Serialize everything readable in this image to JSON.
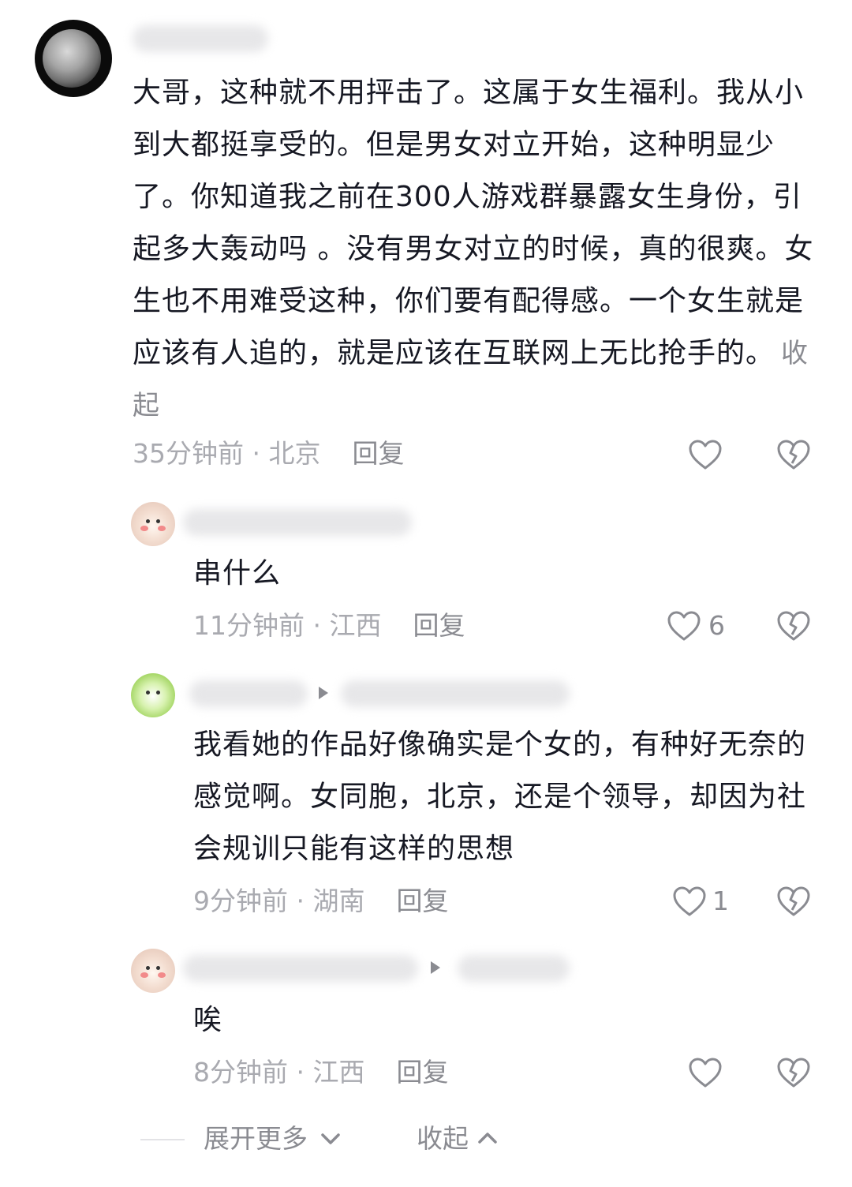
{
  "comment": {
    "text": "大哥，这种就不用抨击了。这属于女生福利。我从小到大都挺享受的。但是男女对立开始，这种明显少了。你知道我之前在300人游戏群暴露女生身份，引起多大轰动吗 。没有男女对立的时候，真的很爽。女生也不用难受这种，你们要有配得感。一个女生就是应该有人追的，就是应该在互联网上无比抢手的。",
    "collapse_label": "收起",
    "meta": "35分钟前 · 北京",
    "reply_label": "回复"
  },
  "replies": [
    {
      "text": "串什么",
      "meta": "11分钟前 · 江西",
      "reply_label": "回复",
      "likes": "6"
    },
    {
      "text": "我看她的作品好像确实是个女的，有种好无奈的感觉啊。女同胞，北京，还是个领导，却因为社会规训只能有这样的思想",
      "meta": "9分钟前 · 湖南",
      "reply_label": "回复",
      "likes": "1"
    },
    {
      "text": "唉",
      "meta": "8分钟前 · 江西",
      "reply_label": "回复",
      "likes": ""
    }
  ],
  "footer": {
    "expand_label": "展开更多",
    "collapse_label": "收起"
  },
  "icons": {
    "like": "heart-outline-icon",
    "dislike": "broken-heart-icon",
    "expand": "chevron-down-icon",
    "collapse": "chevron-up-icon"
  },
  "colors": {
    "text": "#161823",
    "meta": "#a9aab0",
    "secondary": "#8a8b91"
  }
}
